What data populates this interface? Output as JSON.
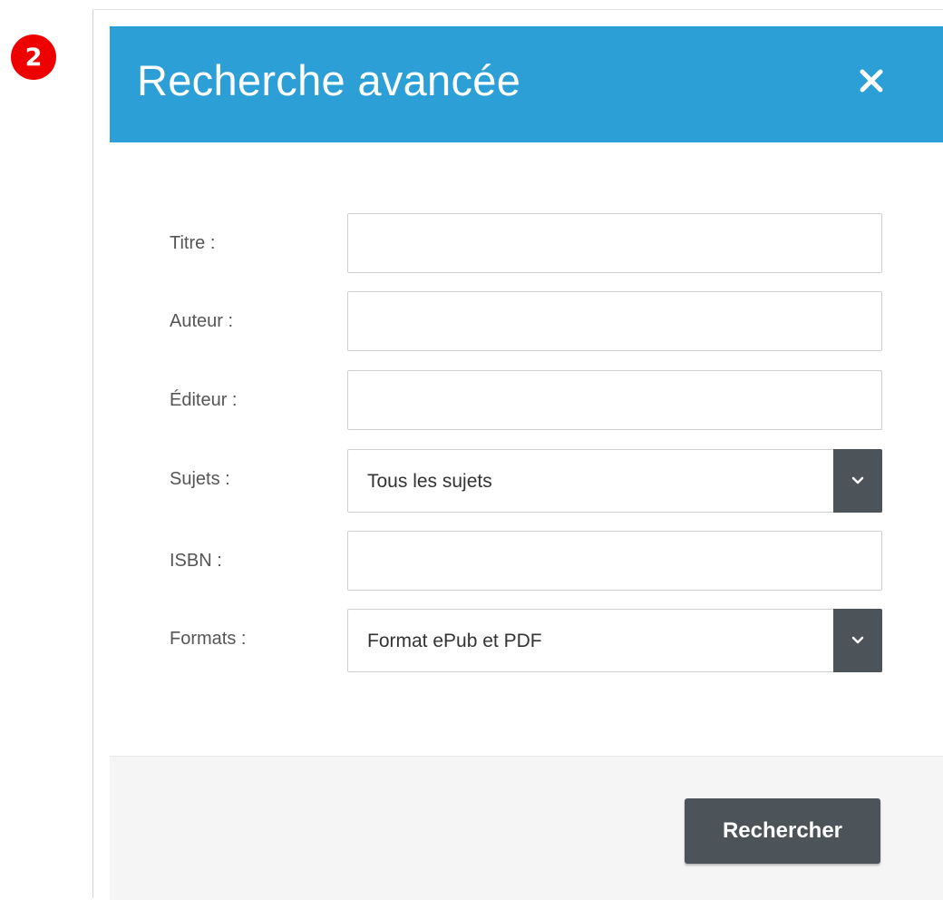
{
  "step_badge": "2",
  "dialog": {
    "title": "Recherche avancée",
    "close_icon": "close-icon",
    "header_color": "#2b9fd6"
  },
  "form": {
    "title": {
      "label": "Titre :",
      "value": ""
    },
    "author": {
      "label": "Auteur :",
      "value": ""
    },
    "publisher": {
      "label": "Éditeur :",
      "value": ""
    },
    "subjects": {
      "label": "Sujets :",
      "selected": "Tous les sujets",
      "icon": "chevron-down-icon"
    },
    "isbn": {
      "label": "ISBN :",
      "value": ""
    },
    "formats": {
      "label": "Formats :",
      "selected": "Format ePub et PDF",
      "icon": "chevron-down-icon"
    }
  },
  "footer": {
    "search_label": "Rechercher",
    "button_color": "#4c5459"
  }
}
